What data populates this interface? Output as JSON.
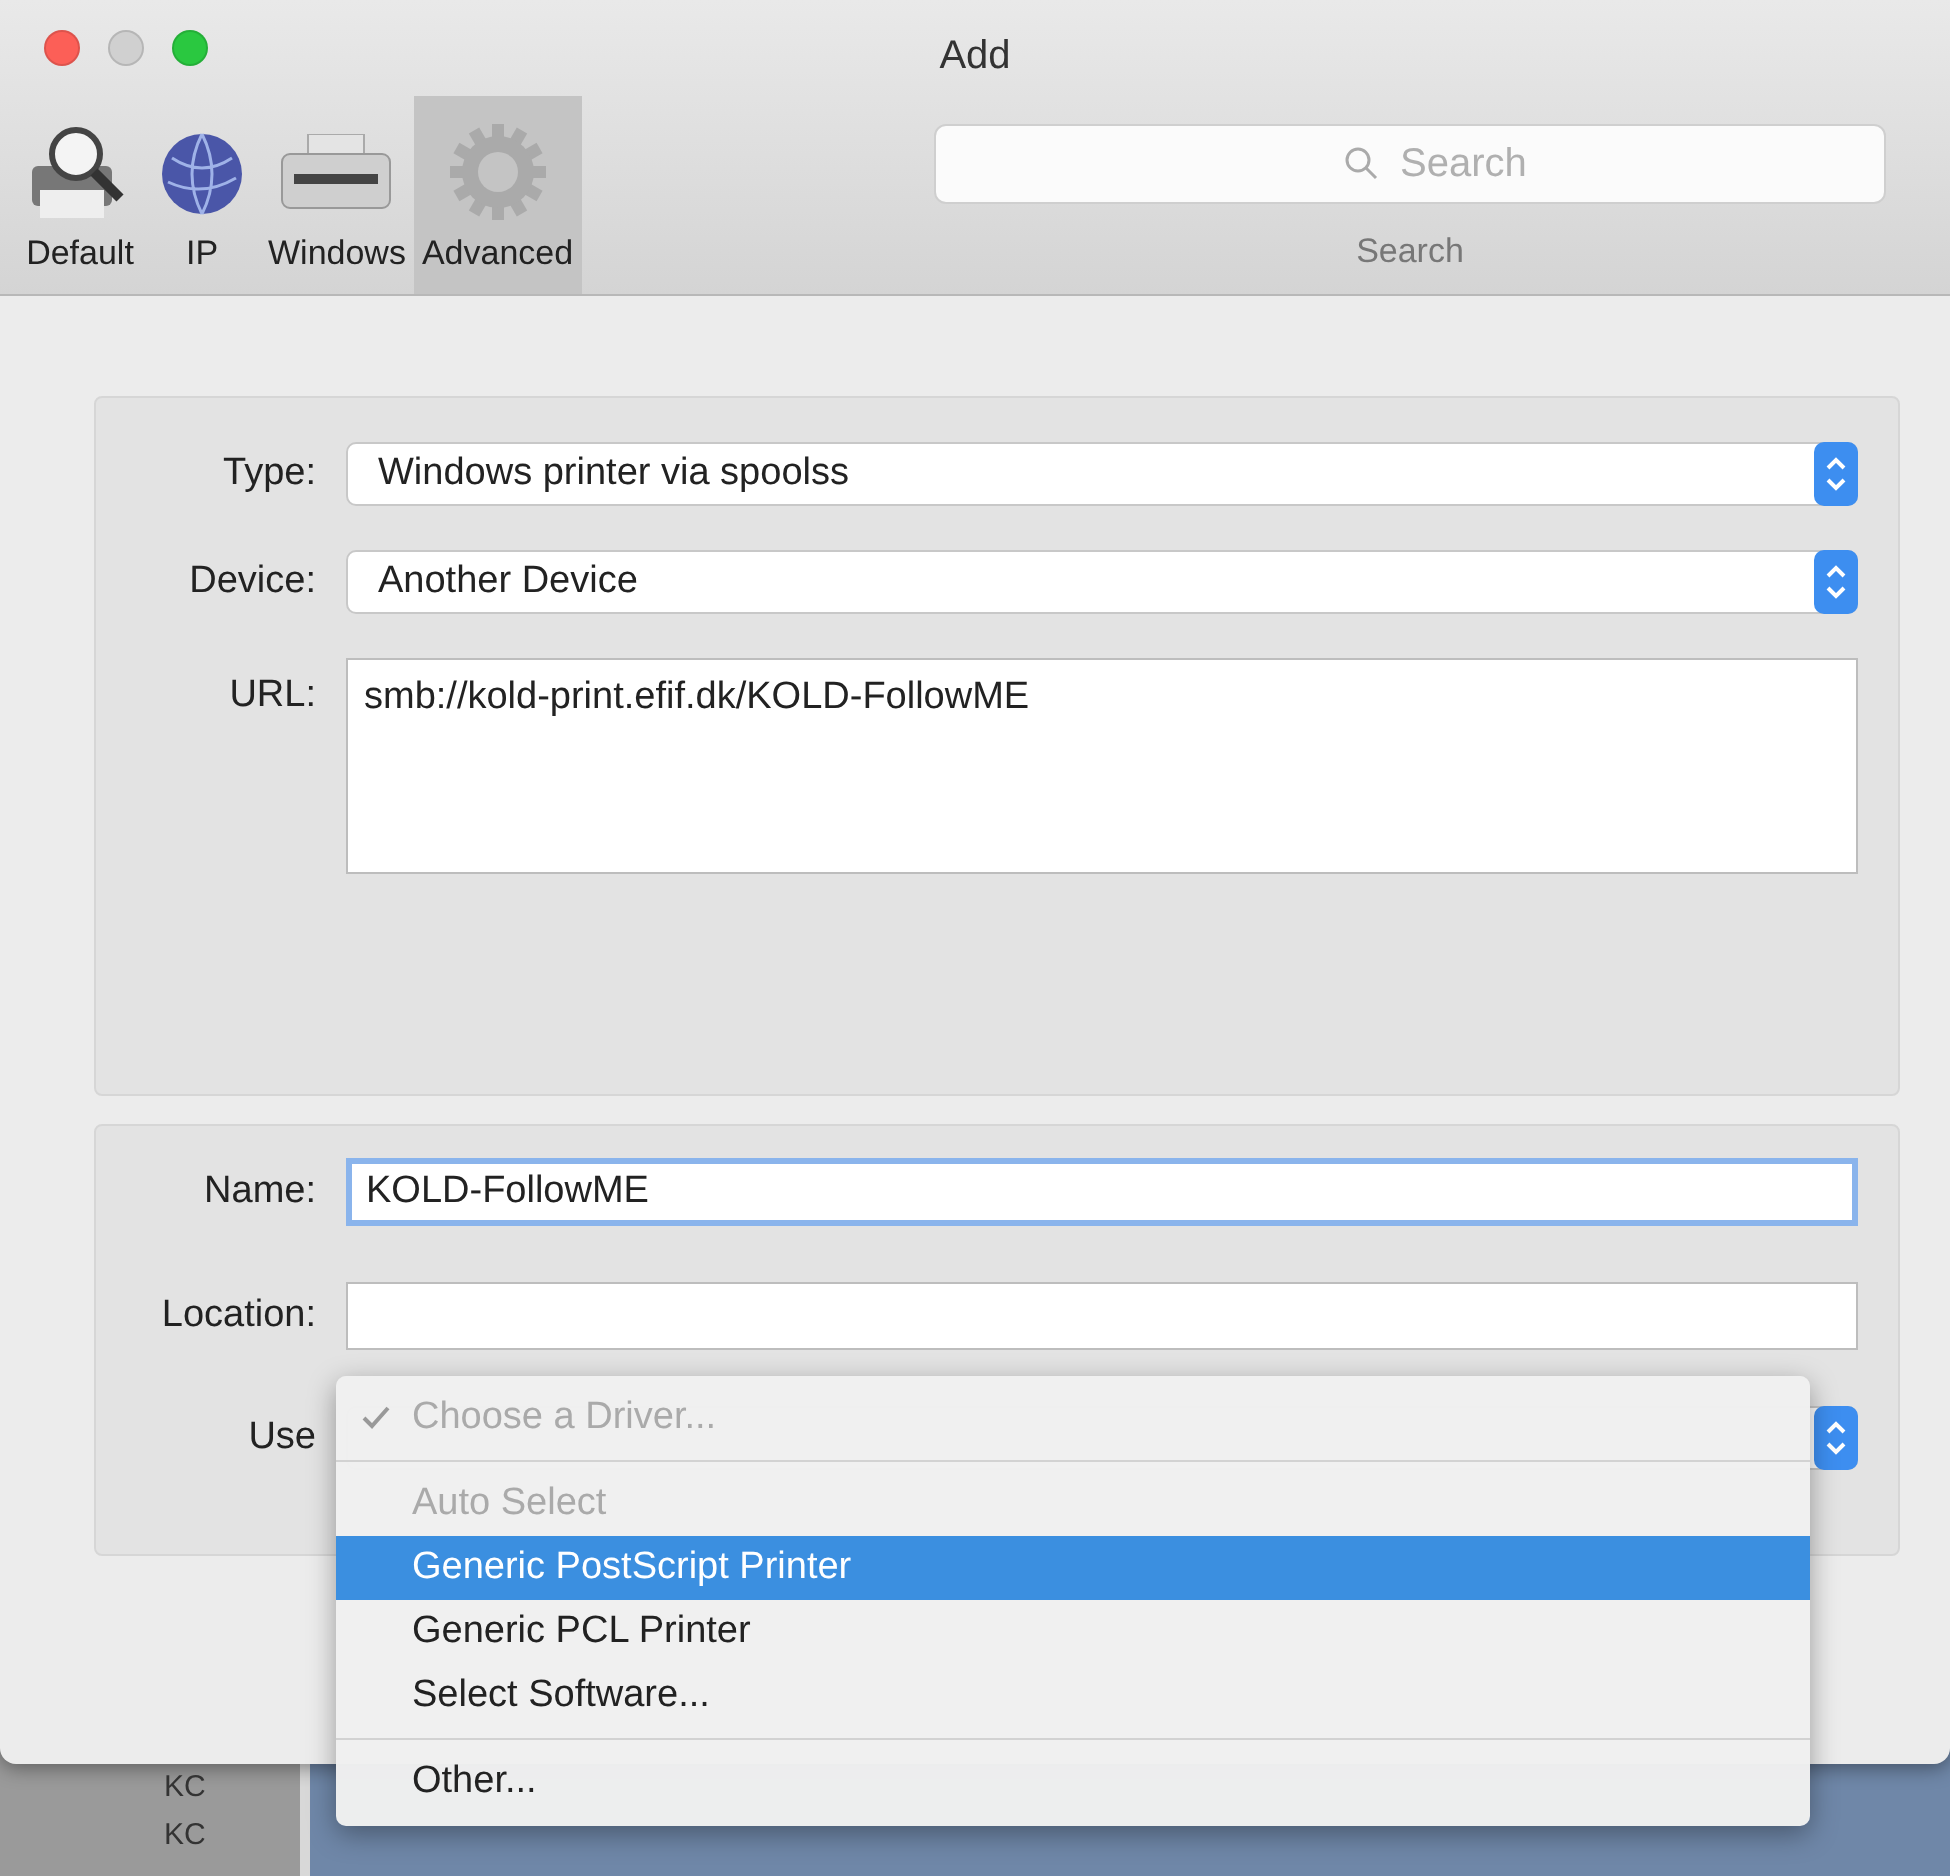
{
  "window": {
    "title": "Add"
  },
  "toolbar": [
    {
      "label": "Default",
      "selected": false
    },
    {
      "label": "IP",
      "selected": false
    },
    {
      "label": "Windows",
      "selected": false
    },
    {
      "label": "Advanced",
      "selected": true
    }
  ],
  "search": {
    "placeholder": "Search",
    "label": "Search"
  },
  "connection": [
    {
      "kind": "select",
      "label": "Type:",
      "value": "Windows printer via spoolss"
    },
    {
      "kind": "select",
      "label": "Device:",
      "value": "Another Device"
    },
    {
      "kind": "textarea",
      "label": "URL:",
      "value": "smb://kold-print.efif.dk/KOLD-FollowME"
    }
  ],
  "details": [
    {
      "kind": "text",
      "label": "Name:",
      "value": "KOLD-FollowME",
      "focused": true
    },
    {
      "kind": "text",
      "label": "Location:",
      "focused": false
    },
    {
      "kind": "select",
      "label": "Use"
    }
  ],
  "driver_menu": [
    {
      "kind": "item",
      "label": "Choose a Driver...",
      "checked": true,
      "disabled": true,
      "selected": false
    },
    {
      "kind": "separator"
    },
    {
      "kind": "item",
      "label": "Auto Select",
      "checked": false,
      "disabled": true,
      "selected": false
    },
    {
      "kind": "item",
      "label": "Generic PostScript Printer",
      "checked": false,
      "disabled": false,
      "selected": true
    },
    {
      "kind": "item",
      "label": "Generic PCL Printer",
      "checked": false,
      "disabled": false,
      "selected": false
    },
    {
      "kind": "item",
      "label": "Select Software...",
      "checked": false,
      "disabled": false,
      "selected": false
    },
    {
      "kind": "separator"
    },
    {
      "kind": "item",
      "label": "Other...",
      "checked": false,
      "disabled": false,
      "selected": false
    }
  ],
  "background_window": {
    "rows": [
      "KC",
      "KC"
    ]
  }
}
